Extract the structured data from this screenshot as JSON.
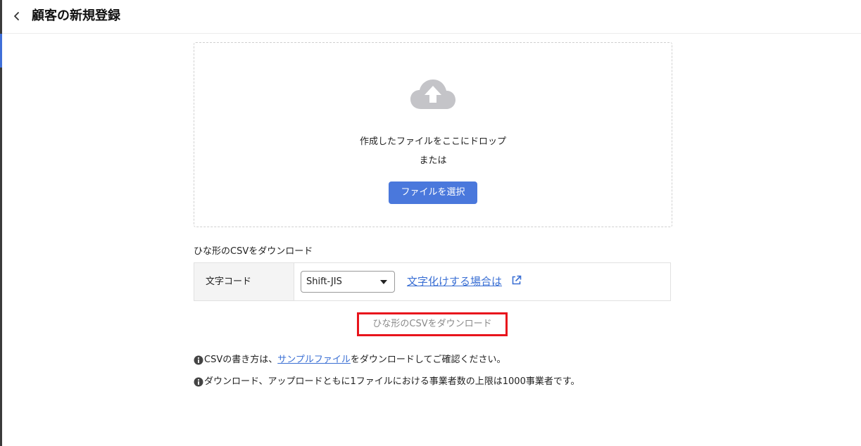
{
  "header": {
    "title": "顧客の新規登録"
  },
  "dropzone": {
    "drop_text": "作成したファイルをここにドロップ",
    "or_text": "または",
    "select_button_label": "ファイルを選択"
  },
  "template_section": {
    "label": "ひな形のCSVをダウンロード",
    "encoding_label": "文字コード",
    "encoding_value": "Shift-JIS",
    "garbled_link_text": "文字化けする場合は",
    "download_button_label": "ひな形のCSVをダウンロード"
  },
  "notes": {
    "note1_prefix": "CSVの書き方は、",
    "note1_link": "サンプルファイル",
    "note1_suffix": "をダウンロードしてご確認ください。",
    "note2": "ダウンロード、アップロードともに1ファイルにおける事業者数の上限は1000事業者です。"
  },
  "colors": {
    "accent": "#4a78dc",
    "link": "#3a6fd4",
    "highlight_border": "#e8141c",
    "cloud_icon": "#c4c4c8"
  },
  "icons": {
    "back": "chevron-left-icon",
    "upload": "cloud-upload-icon",
    "external": "external-link-icon",
    "info": "info-circle-icon",
    "caret": "caret-down-icon"
  }
}
